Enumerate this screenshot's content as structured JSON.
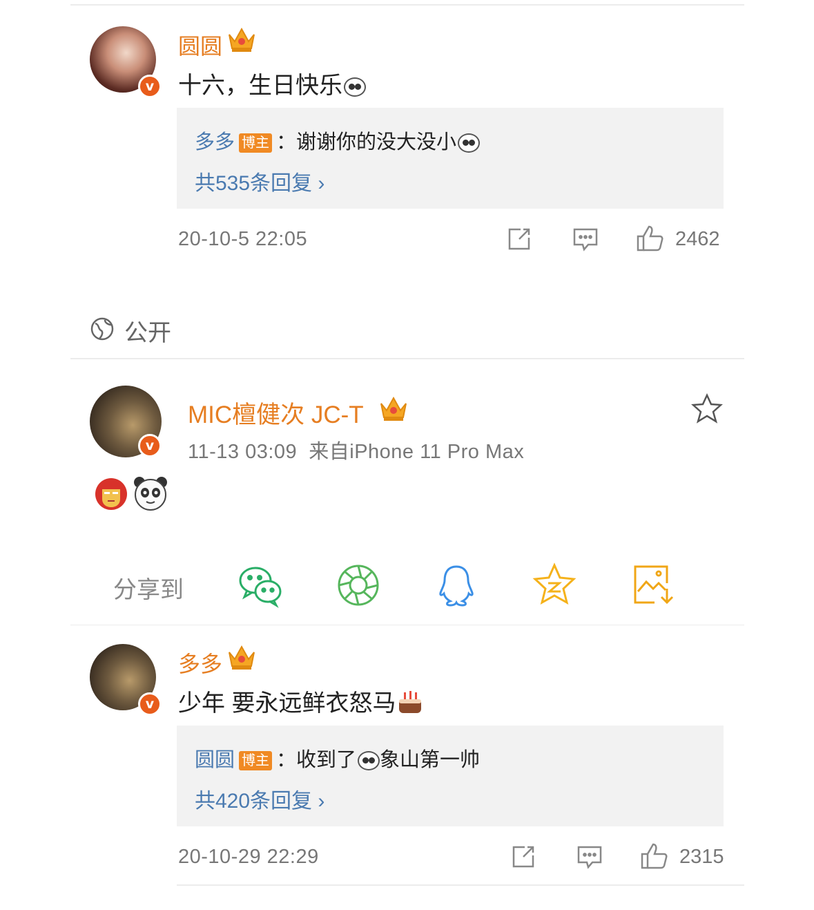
{
  "comment1": {
    "name": "圆圆",
    "badge": "v",
    "text": "十六，生日快乐",
    "reply": {
      "name": "多多",
      "tag": "博主",
      "text": "：谢谢你的没大没小",
      "count": "共535条回复 ›"
    },
    "time": "20-10-5 22:05",
    "likes": "2462"
  },
  "visibility": {
    "label": "公开",
    "icon": "globe-icon"
  },
  "post": {
    "author": "MIC檀健次 JC-T",
    "badge": "v",
    "meta": "11-13 03:09  来自iPhone 11 Pro Max",
    "emojis": [
      "ironman-emoji",
      "panda-emoji"
    ]
  },
  "share": {
    "label": "分享到",
    "targets": [
      "wechat-icon",
      "moments-icon",
      "qq-icon",
      "qzone-icon",
      "save-image-icon"
    ],
    "colors": {
      "wechat": "#2aae67",
      "moments": "#56b65c",
      "qq": "#3b8fe6",
      "qzone": "#f5b21b",
      "save": "#f0a616"
    }
  },
  "comment2": {
    "name": "多多",
    "badge": "v",
    "text": "少年 要永远鲜衣怒马",
    "reply": {
      "name": "圆圆",
      "tag": "博主",
      "text": "：收到了",
      "text2": "象山第一帅",
      "count": "共420条回复 ›"
    },
    "time": "20-10-29 22:29",
    "likes": "2315"
  },
  "colors": {
    "name": "#e67e22",
    "link": "#4a7ab0",
    "badge": "#f08a24",
    "muted": "#777777"
  }
}
